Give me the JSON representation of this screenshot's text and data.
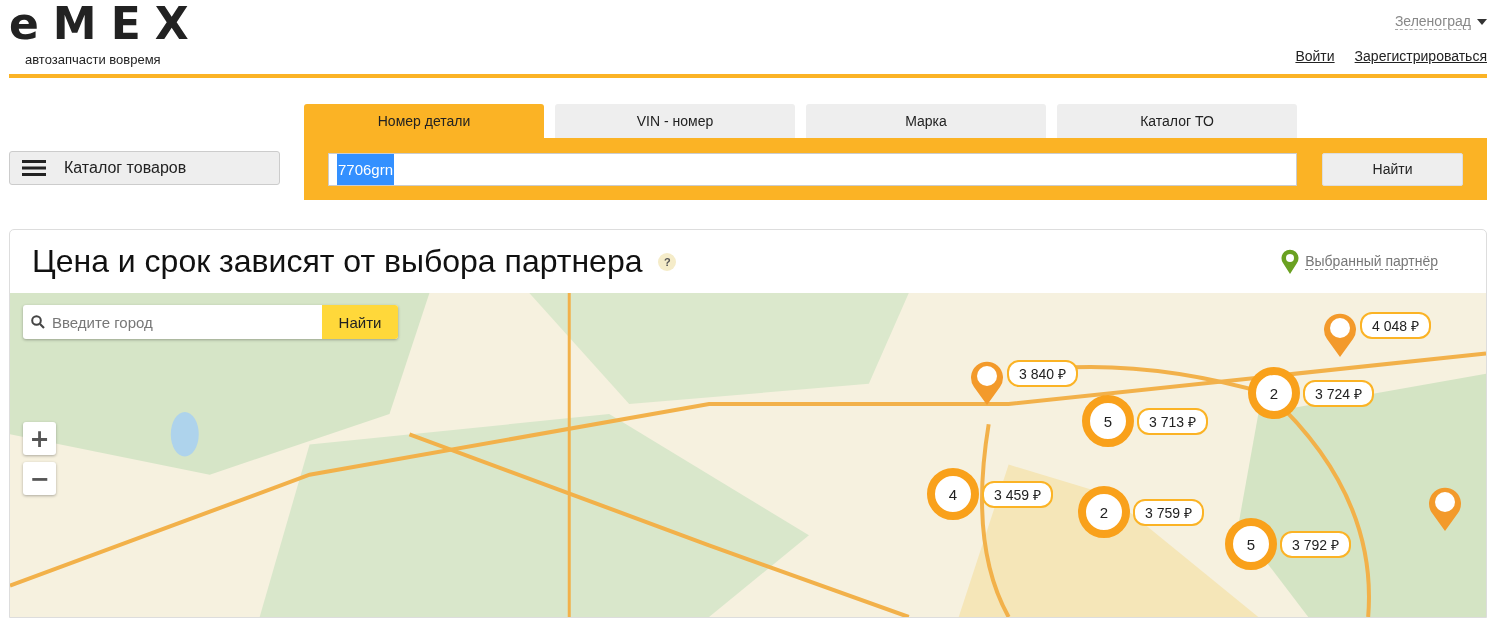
{
  "header": {
    "logo": "eMEX",
    "tagline": "автозапчасти вовремя",
    "city": "Зеленоград",
    "links": [
      "Войти",
      "Зарегистрироваться"
    ]
  },
  "catalog_button": {
    "label": "Каталог товаров"
  },
  "search": {
    "tabs": [
      {
        "label": "Номер детали",
        "selected": true
      },
      {
        "label": "VIN - номер",
        "selected": false
      },
      {
        "label": "Марка",
        "selected": false
      },
      {
        "label": "Каталог ТО",
        "selected": false
      }
    ],
    "value": "7706grn",
    "button": "Найти"
  },
  "partners": {
    "title": "Цена и срок зависят от выбора партнера",
    "help": "?",
    "selected_link": "Выбранный партнёр",
    "map": {
      "city_search": {
        "placeholder": "Введите город",
        "button": "Найти"
      },
      "zoom": [
        "+",
        "−"
      ],
      "markers": [
        {
          "kind": "pin",
          "price": "3 840 ₽"
        },
        {
          "kind": "cluster",
          "count": "5",
          "price": "3 713 ₽"
        },
        {
          "kind": "cluster",
          "count": "2",
          "price": "3 724 ₽"
        },
        {
          "kind": "pin",
          "price": "4 048 ₽"
        },
        {
          "kind": "cluster",
          "count": "4",
          "price": "3 459 ₽"
        },
        {
          "kind": "cluster",
          "count": "2",
          "price": "3 759 ₽"
        },
        {
          "kind": "cluster",
          "count": "5",
          "price": "3 792 ₽"
        },
        {
          "kind": "pin"
        }
      ]
    }
  }
}
